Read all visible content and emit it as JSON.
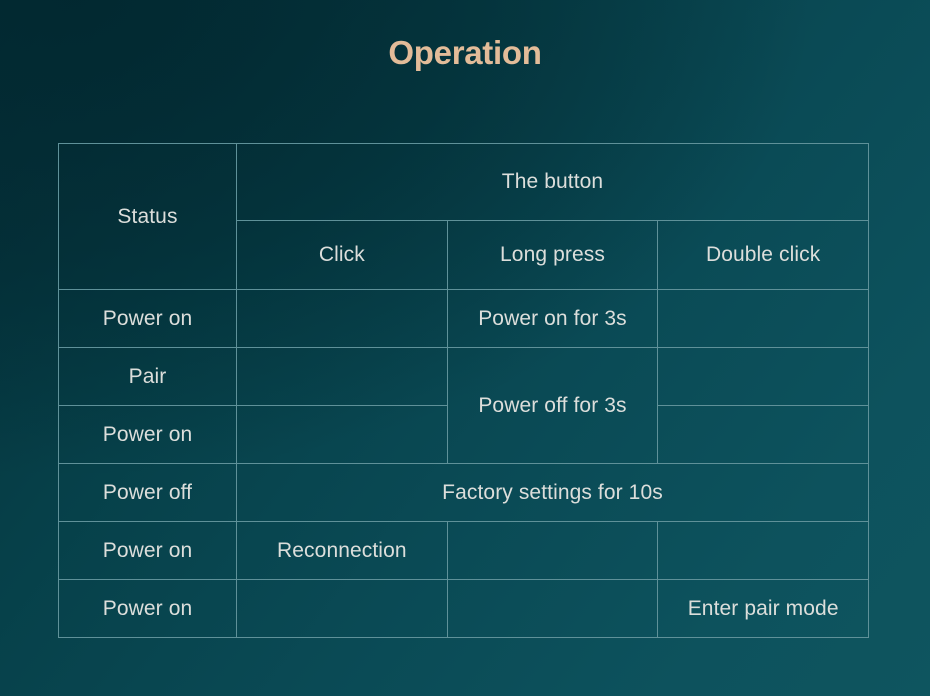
{
  "slide": {
    "title": "Operation",
    "title_color": "#e3bc99",
    "background_color_start": "#053039",
    "background_color_end": "#0e555f",
    "border_color": "#5f9199",
    "text_color": "#dcdedb"
  },
  "table": {
    "header_primary": {
      "status": "Status",
      "button": "The button"
    },
    "header_secondary": {
      "blank": "",
      "click": "Click",
      "long_press": "Long press",
      "double_click": "Double click"
    },
    "rows": [
      {
        "status": "Power on",
        "click": "",
        "long_press": "Power on for 3s",
        "double_click": ""
      },
      {
        "status": "Pair",
        "click": "",
        "long_press": "Power off for 3s",
        "double_click": ""
      },
      {
        "status": "Power on",
        "click": "",
        "long_press": "",
        "double_click": ""
      },
      {
        "status": "Power off",
        "click": "",
        "long_press": "Factory settings for 10s",
        "double_click": ""
      },
      {
        "status": "Power on",
        "click": "Reconnection",
        "long_press": "",
        "double_click": ""
      },
      {
        "status": "Power on",
        "click": "",
        "long_press": "",
        "double_click": "Enter pair mode"
      }
    ]
  }
}
